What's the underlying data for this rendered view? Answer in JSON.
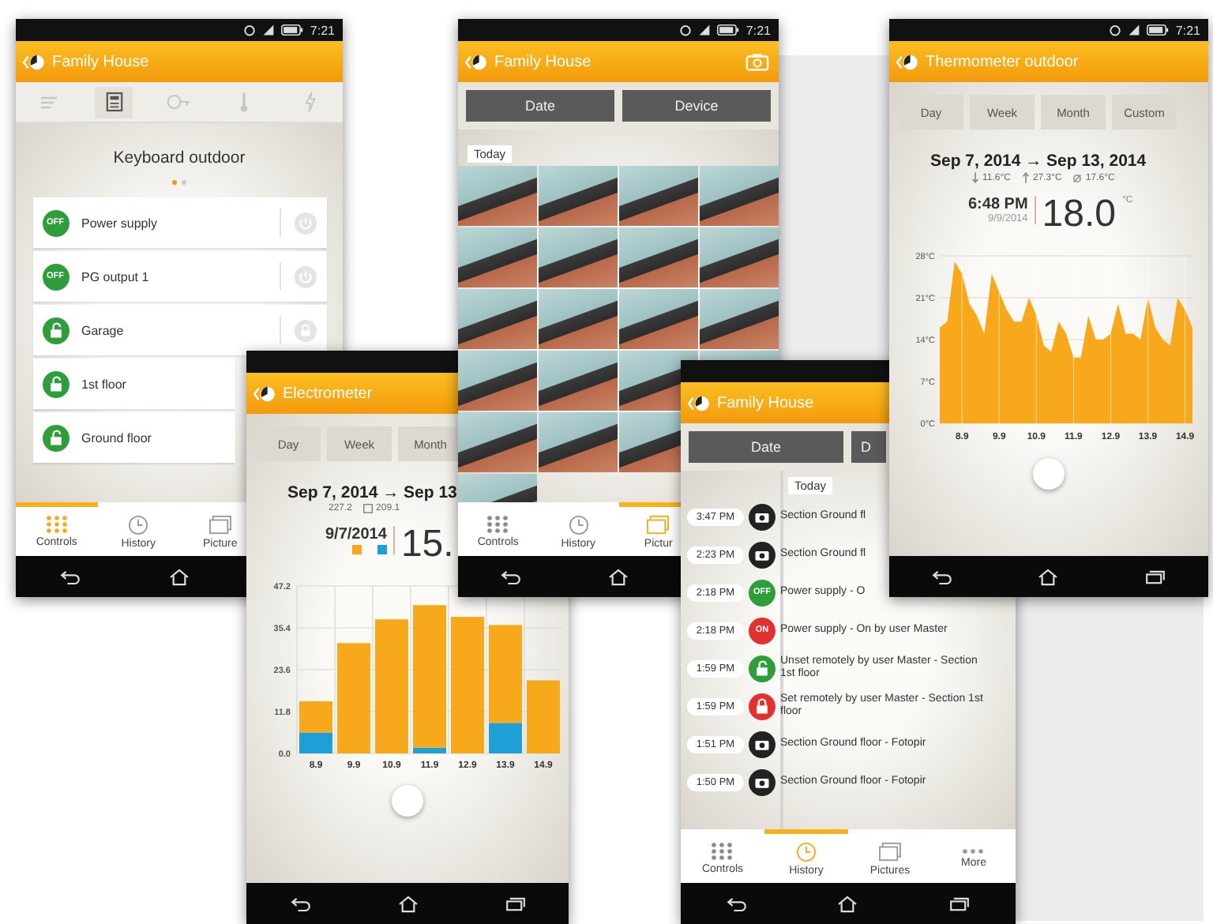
{
  "phones": [
    {
      "kind": "controls",
      "time": "7:21",
      "title": "Family House",
      "header_icons": [
        {
          "kind": "list",
          "selected": false
        },
        {
          "kind": "keypad",
          "selected": true
        },
        {
          "kind": "key",
          "selected": false
        },
        {
          "kind": "thermometer",
          "selected": false
        },
        {
          "kind": "bolt",
          "selected": false
        }
      ],
      "page_title": "Keyboard outdoor",
      "page_dots": [
        {
          "selected": true
        },
        {
          "selected": false
        }
      ],
      "items": [
        {
          "kind": "switch",
          "badge": "OFF",
          "label": "Power supply"
        },
        {
          "kind": "switch",
          "badge": "OFF",
          "label": "PG output 1"
        },
        {
          "kind": "lock",
          "label": "Garage"
        },
        {
          "kind": "lock",
          "label": "1st floor"
        },
        {
          "kind": "lock",
          "label": "Ground floor"
        }
      ],
      "nav": [
        {
          "kind": "controls",
          "label": "Controls",
          "selected": true
        },
        {
          "kind": "history",
          "label": "History",
          "selected": false
        },
        {
          "kind": "pictures",
          "label": "Picture",
          "selected": false
        }
      ]
    },
    {
      "kind": "pictures",
      "time": "7:21",
      "title": "Family House",
      "filters": [
        "Date",
        "Device"
      ],
      "section": "Today",
      "nav": [
        {
          "kind": "controls",
          "label": "Controls",
          "selected": false
        },
        {
          "kind": "history",
          "label": "History",
          "selected": false
        },
        {
          "kind": "pictures",
          "label": "Pictur",
          "selected": true
        }
      ]
    },
    {
      "kind": "thermometer",
      "time": "7:21",
      "title": "Thermometer outdoor",
      "ranges": [
        "Day",
        "Week",
        "Month",
        "Custom"
      ],
      "period": "Sep 7, 2014 → Sep 13, 2014",
      "stats": [
        {
          "kind": "min",
          "value": "11.6°C"
        },
        {
          "kind": "max",
          "value": "27.3°C"
        },
        {
          "kind": "avg",
          "value": "17.6°C"
        }
      ],
      "reading_time": "6:48 PM",
      "reading_date": "9/9/2014",
      "reading": "18.0",
      "unit": "°C",
      "chart_data": {
        "type": "area",
        "grid": true,
        "x": [
          8.3,
          8.5,
          8.7,
          8.9,
          9.1,
          9.3,
          9.5,
          9.7,
          9.9,
          10.1,
          10.3,
          10.5,
          10.7,
          10.9,
          11.1,
          11.3,
          11.5,
          11.7,
          11.9,
          12.1,
          12.3,
          12.5,
          12.7,
          12.9,
          13.1,
          13.3,
          13.5,
          13.7,
          13.9,
          14.1,
          14.3,
          14.5,
          14.7,
          14.9,
          15.1
        ],
        "series": [
          {
            "color": "#f7a81b",
            "values": [
              16,
              17,
              27,
              25,
              20,
              18,
              15,
              25,
              22,
              19,
              17,
              17,
              21,
              18,
              13,
              12,
              17,
              15,
              11,
              11,
              18,
              14,
              14,
              15,
              20,
              15,
              15,
              14,
              21,
              16,
              14,
              13,
              21,
              19,
              16
            ]
          }
        ],
        "xlim": [
          8.3,
          15.1
        ],
        "ylim": [
          0,
          28
        ],
        "xticks": [
          8.9,
          9.9,
          10.9,
          11.9,
          12.9,
          13.9,
          14.9
        ],
        "yticks": [
          {
            "value": 0,
            "label": "0°C"
          },
          {
            "value": 7,
            "label": "7°C"
          },
          {
            "value": 14,
            "label": "14°C"
          },
          {
            "value": 21,
            "label": "21°C"
          },
          {
            "value": 28,
            "label": "28°C"
          }
        ]
      }
    },
    {
      "kind": "electrometer",
      "title": "Electrometer",
      "ranges": [
        "Day",
        "Week",
        "Month"
      ],
      "period": "Sep 7, 2014 → Sep 13",
      "stats": [
        {
          "kind": "total",
          "value": "227.2"
        },
        {
          "kind": "tariff",
          "value": "209.1"
        }
      ],
      "reading_date": "9/7/2014",
      "reading": "15.",
      "chart_data": {
        "type": "bar",
        "stacked": true,
        "grid": true,
        "categories": [
          "8.9",
          "9.9",
          "10.9",
          "11.9",
          "12.9",
          "13.9",
          "14.9"
        ],
        "series": [
          {
            "color": "#1e9fd6",
            "values": [
              5.9,
              0,
              0,
              1.6,
              0,
              8.6,
              0
            ]
          },
          {
            "color": "#f7a81b",
            "values": [
              8.8,
              31.1,
              37.8,
              40.2,
              38.5,
              27.6,
              20.6
            ]
          }
        ],
        "ylim": [
          0,
          47.2
        ],
        "yticks": [
          {
            "value": 0,
            "label": "0.0"
          },
          {
            "value": 11.8,
            "label": "11.8"
          },
          {
            "value": 23.6,
            "label": "23.6"
          },
          {
            "value": 35.4,
            "label": "35.4"
          },
          {
            "value": 47.2,
            "label": "47.2"
          }
        ]
      }
    },
    {
      "kind": "history",
      "title": "Family House",
      "filters": [
        "Date",
        "D"
      ],
      "section": "Today",
      "events": [
        {
          "kind": "camera",
          "time": "3:47 PM",
          "text": "Section Ground fl"
        },
        {
          "kind": "camera",
          "time": "2:23 PM",
          "text": "Section Ground fl"
        },
        {
          "kind": "off",
          "badge": "OFF",
          "time": "2:18 PM",
          "text": "Power supply - O"
        },
        {
          "kind": "on",
          "badge": "ON",
          "time": "2:18 PM",
          "text": "Power supply - On  by user Master"
        },
        {
          "kind": "unset",
          "time": "1:59 PM",
          "text": "Unset remotely  by user Master - Section 1st floor"
        },
        {
          "kind": "set",
          "time": "1:59 PM",
          "text": "Set remotely by user Master - Section 1st floor"
        },
        {
          "kind": "camera",
          "time": "1:51 PM",
          "text": "Section Ground floor  - Fotopir"
        },
        {
          "kind": "camera",
          "time": "1:50 PM",
          "text": "Section Ground floor  - Fotopir"
        }
      ],
      "nav": [
        {
          "kind": "controls",
          "label": "Controls",
          "selected": false
        },
        {
          "kind": "history",
          "label": "History",
          "selected": true
        },
        {
          "kind": "pictures",
          "label": "Pictures",
          "selected": false
        },
        {
          "kind": "more",
          "label": "More",
          "selected": false
        }
      ]
    }
  ]
}
